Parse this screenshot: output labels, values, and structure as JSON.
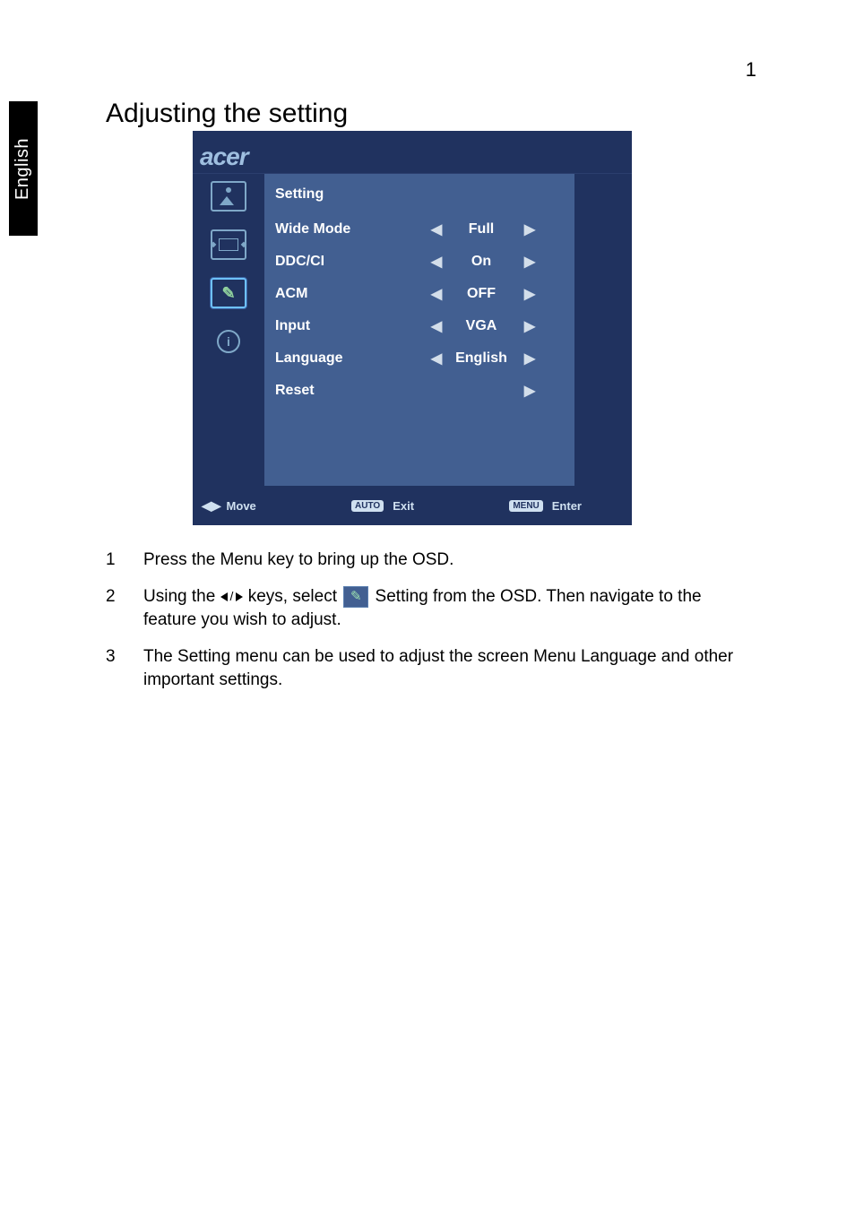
{
  "page_number": "1",
  "language_tab": "English",
  "title": "Adjusting the setting",
  "osd": {
    "brand": "acer",
    "section_title": "Setting",
    "rows": [
      {
        "label": "Wide Mode",
        "value": "Full",
        "has_left": true,
        "has_right": true
      },
      {
        "label": "DDC/CI",
        "value": "On",
        "has_left": true,
        "has_right": true
      },
      {
        "label": "ACM",
        "value": "OFF",
        "has_left": true,
        "has_right": true
      },
      {
        "label": "Input",
        "value": "VGA",
        "has_left": true,
        "has_right": true
      },
      {
        "label": "Language",
        "value": "English",
        "has_left": true,
        "has_right": true
      },
      {
        "label": "Reset",
        "value": "",
        "has_left": false,
        "has_right": true
      }
    ],
    "footer": {
      "move_label": "Move",
      "auto_label": "AUTO",
      "exit_label": "Exit",
      "menu_label": "MENU",
      "enter_label": "Enter"
    },
    "icons": [
      {
        "name": "picture-icon",
        "active": false
      },
      {
        "name": "adjust-icon",
        "active": false
      },
      {
        "name": "setting-icon",
        "active": true
      },
      {
        "name": "info-icon",
        "active": false
      }
    ]
  },
  "steps": {
    "1": {
      "num": "1",
      "text": "Press the Menu key to bring up the OSD."
    },
    "2": {
      "num": "2",
      "pre": "Using the ",
      "mid": " keys, select ",
      "post": " Setting from the OSD. Then navigate to the feature you wish to adjust."
    },
    "3": {
      "num": "3",
      "text": "The Setting menu can be used to adjust the screen Menu Language and other important settings."
    }
  }
}
